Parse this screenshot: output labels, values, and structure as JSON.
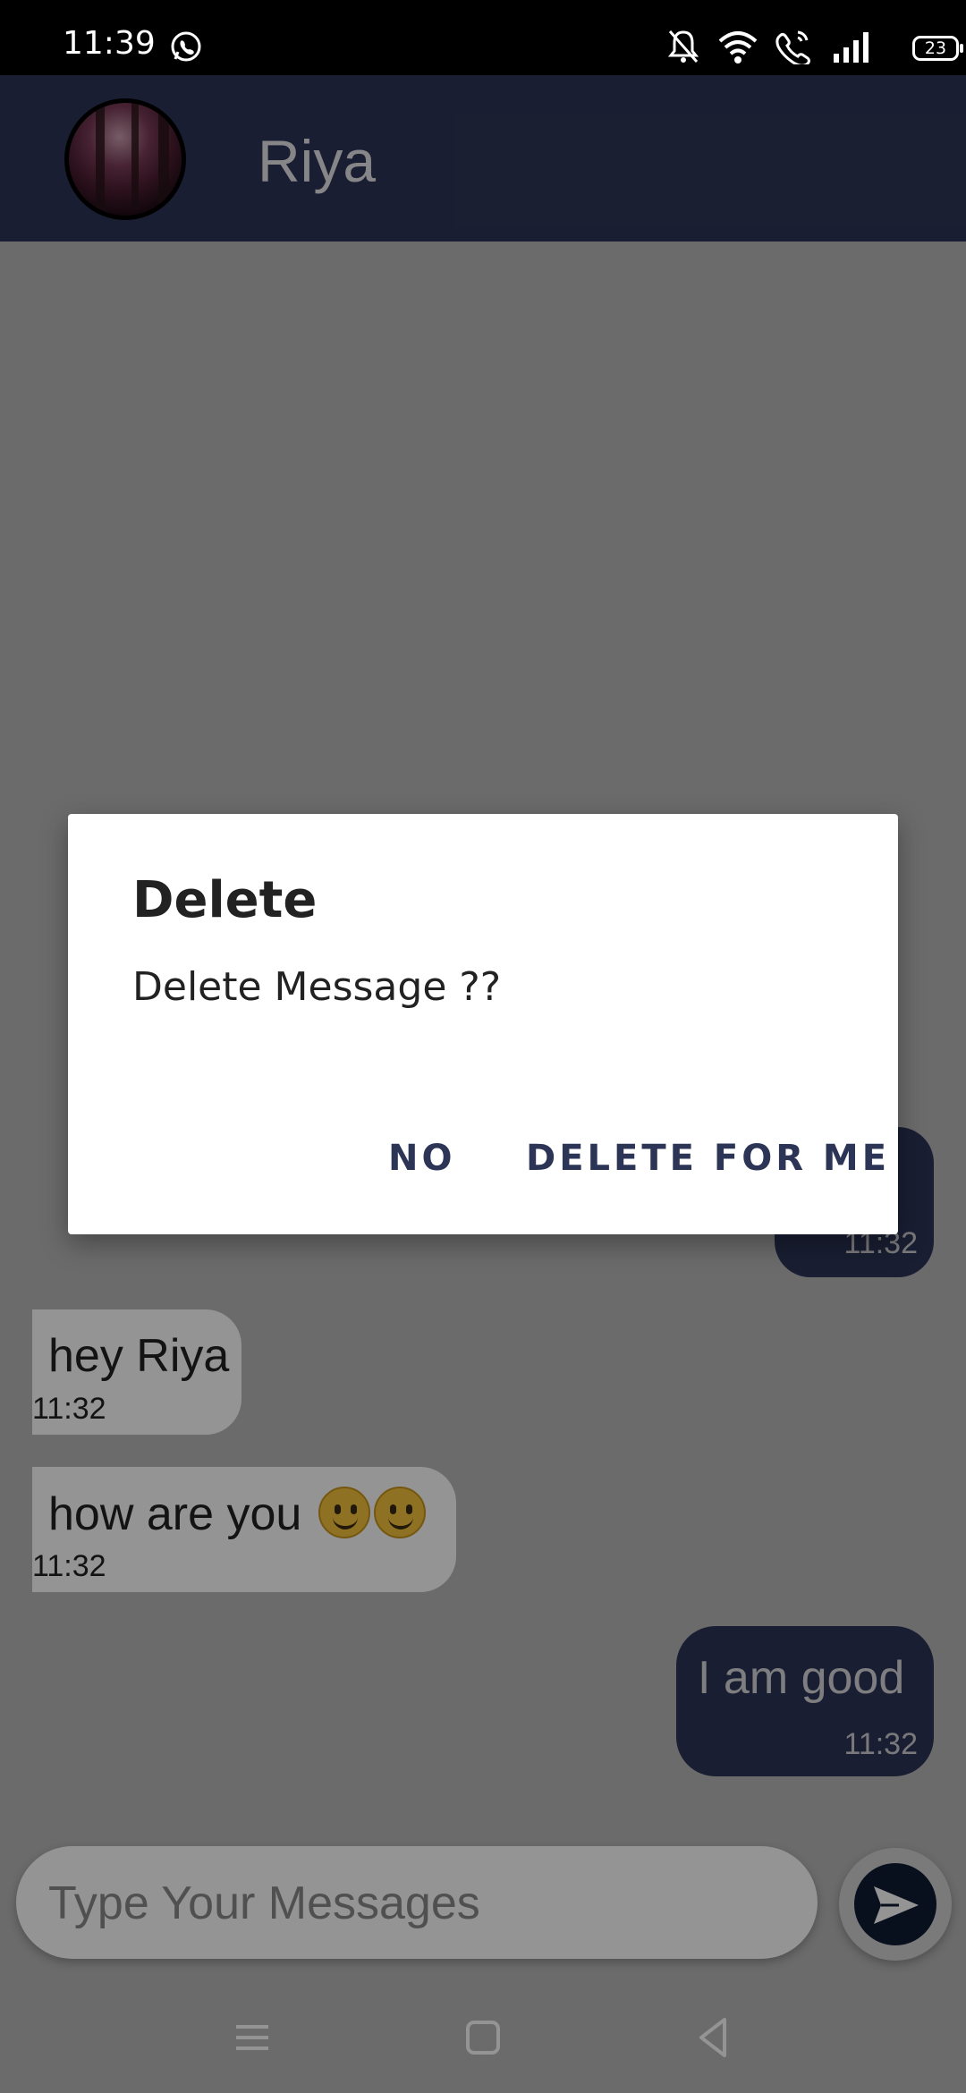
{
  "status_bar": {
    "time": "11:39",
    "battery": "23"
  },
  "header": {
    "contact_name": "Riya"
  },
  "messages": [
    {
      "direction": "outgoing",
      "text": "",
      "time": "11:32"
    },
    {
      "direction": "incoming",
      "text": "hey Riya",
      "time": "11:32"
    },
    {
      "direction": "incoming",
      "text": "how are you",
      "emoji": [
        "slightly-smiling-face",
        "slightly-smiling-face"
      ],
      "time": "11:32"
    },
    {
      "direction": "outgoing",
      "text": "I am good",
      "time": "11:32"
    }
  ],
  "composer": {
    "placeholder": "Type Your Messages",
    "send_icon": "send-icon"
  },
  "dialog": {
    "title": "Delete",
    "message": "Delete Message ??",
    "buttons": {
      "negative": "NO",
      "positive": "DELETE FOR ME"
    }
  },
  "colors": {
    "primary": "#2c3556",
    "send_button": "#0f1a33",
    "dialog_button_text": "#2c3556"
  }
}
